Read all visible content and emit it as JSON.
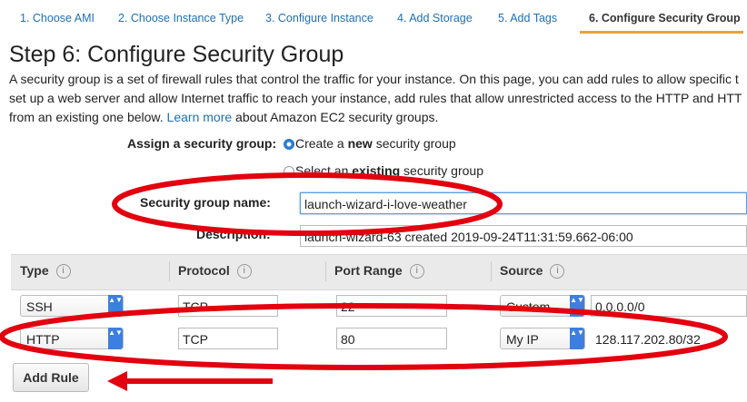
{
  "tabs": [
    {
      "label": "1. Choose AMI"
    },
    {
      "label": "2. Choose Instance Type"
    },
    {
      "label": "3. Configure Instance"
    },
    {
      "label": "4. Add Storage"
    },
    {
      "label": "5. Add Tags"
    },
    {
      "label": "6. Configure Security Group"
    }
  ],
  "active_tab": 6,
  "page": {
    "title": "Step 6: Configure Security Group",
    "desc_line1": "A security group is a set of firewall rules that control the traffic for your instance. On this page, you can add rules to allow specific t",
    "desc_line2": "set up a web server and allow Internet traffic to reach your instance, add rules that allow unrestricted access to the HTTP and HTT",
    "desc_line3_pre": "from an existing one below.",
    "desc_link": "Learn more",
    "desc_line3_post": "about Amazon EC2 security groups."
  },
  "form": {
    "assign_label": "Assign a security group:",
    "option_create_pre": "Create a ",
    "option_create_bold": "new",
    "option_create_post": " security group",
    "option_existing_pre": "Select an ",
    "option_existing_bold": "existing",
    "option_existing_post": " security group",
    "selected_option": "create",
    "name_label": "Security group name:",
    "name_value": "launch-wizard-i-love-weather",
    "desc_label": "Description:",
    "desc_value": "launch-wizard-63 created 2019-09-24T11:31:59.662-06:00"
  },
  "table": {
    "headers": {
      "type": "Type",
      "protocol": "Protocol",
      "port": "Port Range",
      "source": "Source"
    },
    "info_glyph": "i",
    "rows": [
      {
        "type": "SSH",
        "protocol": "TCP",
        "port": "22",
        "source": "Custom",
        "cidr": "0.0.0.0/0"
      },
      {
        "type": "HTTP",
        "protocol": "TCP",
        "port": "80",
        "source": "My IP",
        "cidr": "128.117.202.80/32"
      }
    ]
  },
  "add_rule_label": "Add Rule",
  "select_arrow_glyph": "▲▼",
  "colors": {
    "link": "#1f6fb2",
    "active_tab_underline": "#e8a33d",
    "annotation": "#e3000f",
    "select_arrow": "#3d7fe0"
  }
}
